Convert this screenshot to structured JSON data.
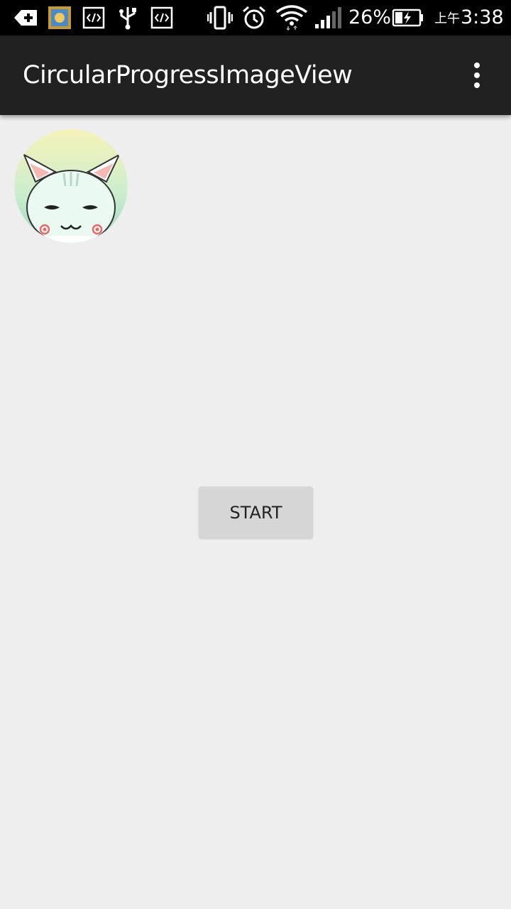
{
  "status_bar": {
    "icons": [
      "add-box-icon",
      "app-notification-icon",
      "code-icon",
      "usb-icon",
      "code-icon",
      "vibrate-icon",
      "alarm-icon",
      "wifi-icon",
      "signal-icon",
      "battery-charging-icon"
    ],
    "battery_percent": "26%",
    "ampm": "上午",
    "time": "3:38"
  },
  "toolbar": {
    "title": "CircularProgressImageView",
    "overflow_icon": "more-vert-icon",
    "background": "#212121"
  },
  "avatar": {
    "icon": "cat-avatar-image"
  },
  "main": {
    "start_label": "START"
  },
  "colors": {
    "background": "#eeeeee",
    "button": "#d6d6d6"
  }
}
